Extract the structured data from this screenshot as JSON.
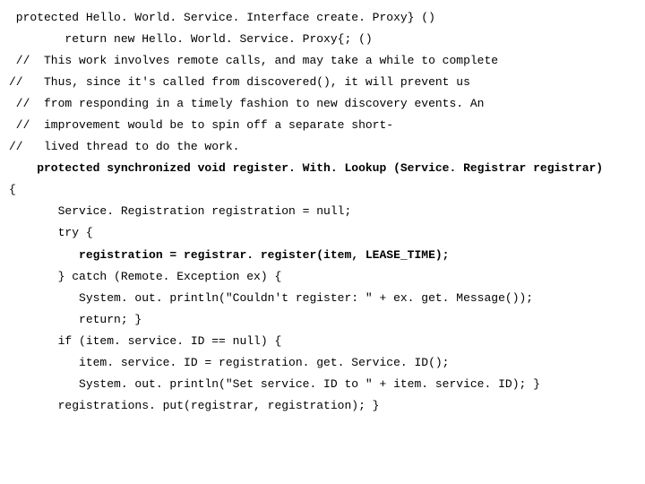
{
  "code": {
    "l1": " protected Hello. World. Service. Interface create. Proxy} ()",
    "l2": "        return new Hello. World. Service. Proxy{; ()",
    "l3": " //  This work involves remote calls, and may take a while to complete",
    "l4": "//   Thus, since it's called from discovered(), it will prevent us",
    "l5": " //  from responding in a timely fashion to new discovery events. An",
    "l6": " //  improvement would be to spin off a separate short-",
    "l7": "//   lived thread to do the work.",
    "l8": "    protected synchronized void register. With. Lookup (Service. Registrar registrar)",
    "l9": "{",
    "l10": "       Service. Registration registration = null;",
    "l11": "       try {",
    "l12": "          registration = registrar. register(item, LEASE_TIME);",
    "l13": "       } catch (Remote. Exception ex) {",
    "l14": "          System. out. println(\"Couldn't register: \" + ex. get. Message());",
    "l15": "          return; }",
    "l16": "       if (item. service. ID == null) {",
    "l17": "          item. service. ID = registration. get. Service. ID();",
    "l18": "          System. out. println(\"Set service. ID to \" + item. service. ID); }",
    "l19": "       registrations. put(registrar, registration); }"
  }
}
